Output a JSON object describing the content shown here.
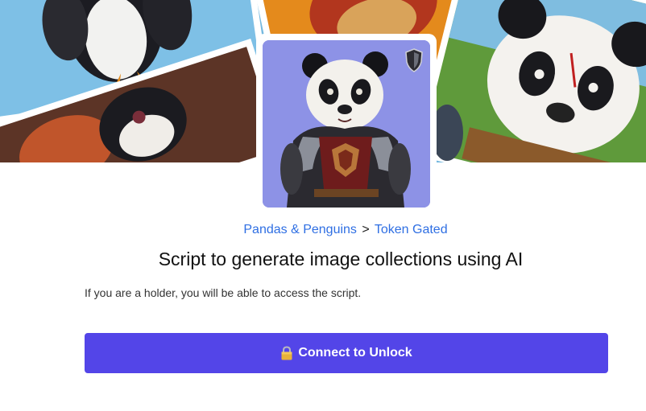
{
  "breadcrumb": {
    "collection": "Pandas & Penguins",
    "separator": ">",
    "section": "Token Gated"
  },
  "page": {
    "title": "Script to generate image collections using AI",
    "description": "If you are a holder, you will be able to access the script."
  },
  "unlock_button": {
    "label": "Connect to Unlock",
    "icon": "lock-icon"
  },
  "banner": {
    "icon": "collage-banner-image"
  },
  "avatar": {
    "icon": "armored-panda-image",
    "badge_icon": "shield-icon"
  },
  "colors": {
    "button": "#5345e8",
    "link": "#2f6fe3",
    "avatar_bg": "#8d92e6",
    "banner_sky": "#6fb2dd"
  }
}
